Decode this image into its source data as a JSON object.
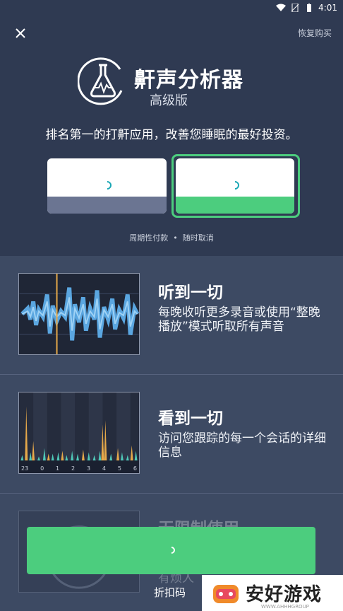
{
  "status_bar": {
    "time": "4:01"
  },
  "header": {
    "restore_label": "恢复购买",
    "title": "鼾声分析器",
    "subtitle": "高级版",
    "tagline": "排名第一的打鼾应用，改善您睡眠的最好投资。",
    "terms_left": "周期性付款",
    "terms_right": "随时取消"
  },
  "features": [
    {
      "title": "听到一切",
      "desc": "每晚收听更多录音或使用“整晚播放”模式听取所有声音"
    },
    {
      "title": "看到一切",
      "desc": "访问您跟踪的每一个会话的详细信息"
    },
    {
      "title": "无限制使用",
      "desc": "有烦人"
    }
  ],
  "chart2_ticks": [
    "23",
    "0",
    "1",
    "2",
    "3",
    "4",
    "5",
    "6"
  ],
  "cta": {
    "discount_label": "折扣码"
  },
  "watermark": {
    "text": "安好游戏",
    "sub": "WWW.AHHHGROUP"
  },
  "colors": {
    "accent": "#4ccd7e",
    "header_bg": "#2f3a52",
    "body_bg": "#3d4a63"
  }
}
